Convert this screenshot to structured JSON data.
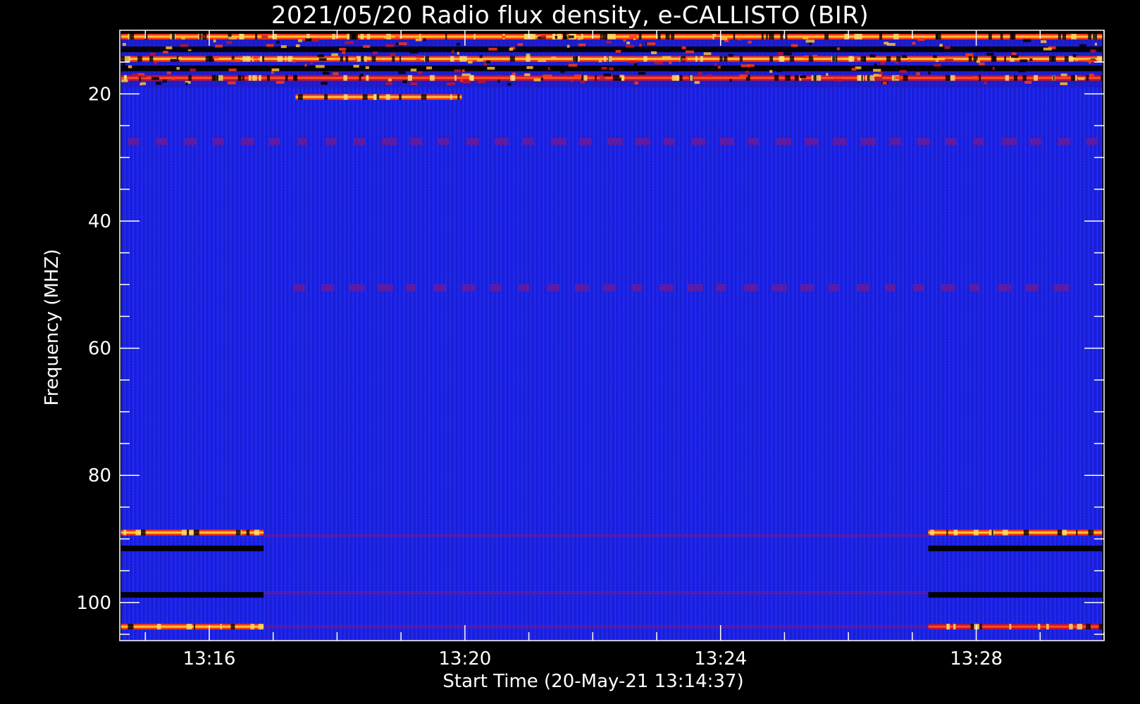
{
  "chart_data": {
    "type": "heatmap",
    "title": "2021/05/20  Radio flux density, e-CALLISTO (BIR)",
    "xlabel": "Start Time (20-May-21 13:14:37)",
    "ylabel": "Frequency (MHZ)",
    "x_ticks": [
      "13:16",
      "13:20",
      "13:24",
      "13:28"
    ],
    "x_tick_minutes": [
      16,
      20,
      24,
      28
    ],
    "x_range_minutes": [
      14.6,
      30.0
    ],
    "y_ticks": [
      20,
      40,
      60,
      80,
      100
    ],
    "y_range_mhz": [
      10,
      106
    ],
    "data_time_start_minute": 14.62,
    "data_time_end_minute": 29.97,
    "background_color": "#1c22e6",
    "colormap": [
      "#000000",
      "#1c22e6",
      "#b0102a",
      "#ff3a10",
      "#ffb020",
      "#ffff80"
    ],
    "features": [
      {
        "kind": "horizontal_band",
        "freq_mhz": 11,
        "t_start": 14.62,
        "t_end": 29.97,
        "intensity": "bright"
      },
      {
        "kind": "horizontal_band",
        "freq_mhz": 13,
        "t_start": 14.62,
        "t_end": 29.97,
        "intensity": "dark"
      },
      {
        "kind": "horizontal_band",
        "freq_mhz": 14.5,
        "t_start": 14.62,
        "t_end": 29.97,
        "intensity": "bright"
      },
      {
        "kind": "horizontal_band",
        "freq_mhz": 16,
        "t_start": 14.62,
        "t_end": 29.97,
        "intensity": "mixed"
      },
      {
        "kind": "horizontal_band",
        "freq_mhz": 17.5,
        "t_start": 14.62,
        "t_end": 29.97,
        "intensity": "medium"
      },
      {
        "kind": "horizontal_band",
        "freq_mhz": 20.5,
        "t_start": 17.35,
        "t_end": 19.95,
        "intensity": "bright"
      },
      {
        "kind": "dashed_band",
        "freq_mhz": 27.5,
        "t_start": 14.62,
        "t_end": 29.97,
        "intensity": "weak"
      },
      {
        "kind": "dashed_band",
        "freq_mhz": 50.5,
        "t_start": 17.2,
        "t_end": 29.5,
        "intensity": "weak"
      },
      {
        "kind": "horizontal_band",
        "freq_mhz": 89,
        "t_start": 14.62,
        "t_end": 16.85,
        "intensity": "bright"
      },
      {
        "kind": "horizontal_band",
        "freq_mhz": 91.5,
        "t_start": 14.62,
        "t_end": 16.85,
        "intensity": "dark"
      },
      {
        "kind": "horizontal_band",
        "freq_mhz": 98.8,
        "t_start": 14.62,
        "t_end": 16.85,
        "intensity": "dark"
      },
      {
        "kind": "horizontal_band",
        "freq_mhz": 103.8,
        "t_start": 14.62,
        "t_end": 16.85,
        "intensity": "bright"
      },
      {
        "kind": "horizontal_band",
        "freq_mhz": 89,
        "t_start": 27.25,
        "t_end": 29.97,
        "intensity": "bright"
      },
      {
        "kind": "horizontal_band",
        "freq_mhz": 91.5,
        "t_start": 27.25,
        "t_end": 29.97,
        "intensity": "dark"
      },
      {
        "kind": "horizontal_band",
        "freq_mhz": 98.8,
        "t_start": 27.25,
        "t_end": 29.97,
        "intensity": "dark"
      },
      {
        "kind": "horizontal_band",
        "freq_mhz": 103.8,
        "t_start": 27.25,
        "t_end": 29.97,
        "intensity": "medium"
      },
      {
        "kind": "horizontal_band",
        "freq_mhz": 89.5,
        "t_start": 16.85,
        "t_end": 27.25,
        "intensity": "weak"
      },
      {
        "kind": "horizontal_band",
        "freq_mhz": 98.5,
        "t_start": 16.85,
        "t_end": 27.25,
        "intensity": "weak"
      },
      {
        "kind": "horizontal_band",
        "freq_mhz": 103.8,
        "t_start": 16.85,
        "t_end": 27.25,
        "intensity": "weak"
      }
    ]
  }
}
